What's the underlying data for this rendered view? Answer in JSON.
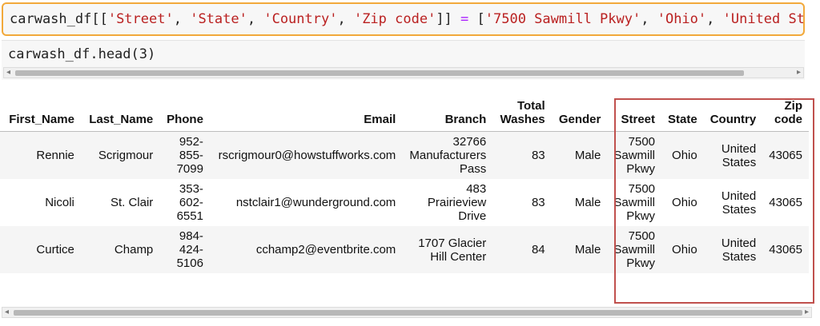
{
  "code_cell_1": {
    "prefix": "carwash_df[[",
    "cols": [
      "'Street'",
      "'State'",
      "'Country'",
      "'Zip code'"
    ],
    "mid": "]] ",
    "eq": "=",
    "vals": [
      "'7500 Sawmill Pkwy'",
      "'Ohio'",
      "'United States'"
    ]
  },
  "code_cell_2": {
    "line": "carwash_df.head(3)"
  },
  "table": {
    "headers": {
      "first_name": "First_Name",
      "last_name": "Last_Name",
      "phone": "Phone",
      "email": "Email",
      "branch": "Branch",
      "total_washes_1": "Total",
      "total_washes_2": "Washes",
      "gender": "Gender",
      "street": "Street",
      "state": "State",
      "country": "Country",
      "zip_1": "Zip",
      "zip_2": "code"
    },
    "rows": [
      {
        "first_name": "Rennie",
        "last_name": "Scrigmour",
        "phone": [
          "952-",
          "855-",
          "7099"
        ],
        "email": "rscrigmour0@howstuffworks.com",
        "branch": [
          "32766",
          "Manufacturers",
          "Pass"
        ],
        "washes": "83",
        "gender": "Male",
        "street": [
          "7500",
          "Sawmill",
          "Pkwy"
        ],
        "state": "Ohio",
        "country": [
          "United",
          "States"
        ],
        "zip": "43065"
      },
      {
        "first_name": "Nicoli",
        "last_name": "St. Clair",
        "phone": [
          "353-",
          "602-",
          "6551"
        ],
        "email": "nstclair1@wunderground.com",
        "branch": [
          "483",
          "Prairieview",
          "Drive"
        ],
        "washes": "83",
        "gender": "Male",
        "street": [
          "7500",
          "Sawmill",
          "Pkwy"
        ],
        "state": "Ohio",
        "country": [
          "United",
          "States"
        ],
        "zip": "43065"
      },
      {
        "first_name": "Curtice",
        "last_name": "Champ",
        "phone": [
          "984-",
          "424-",
          "5106"
        ],
        "email": "cchamp2@eventbrite.com",
        "branch": [
          "1707 Glacier",
          "Hill Center"
        ],
        "washes": "84",
        "gender": "Male",
        "street": [
          "7500",
          "Sawmill",
          "Pkwy"
        ],
        "state": "Ohio",
        "country": [
          "United",
          "States"
        ],
        "zip": "43065"
      }
    ]
  },
  "scroll": {
    "left_arrow": "◂",
    "right_arrow": "▸"
  },
  "colors": {
    "cell_highlight": "#f2a93b",
    "column_highlight": "#c0504d",
    "string": "#ba2121",
    "operator": "#aa22ff"
  }
}
